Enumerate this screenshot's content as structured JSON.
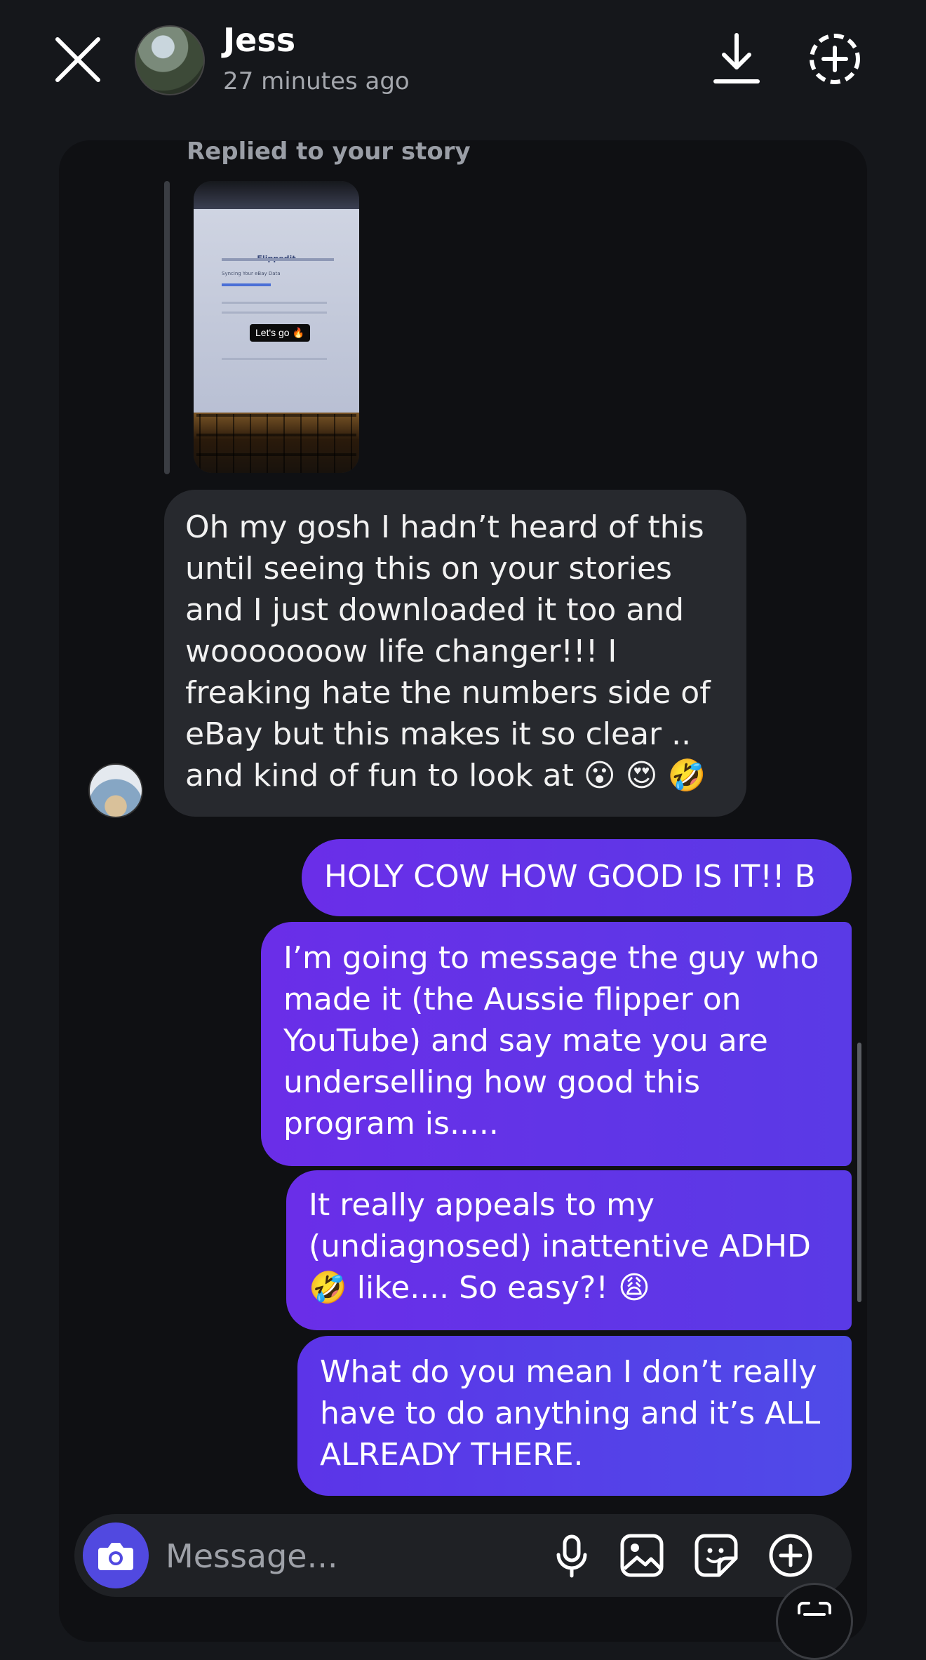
{
  "header": {
    "contact_name": "Jess",
    "last_active": "27 minutes ago",
    "icons": [
      "close-icon",
      "download-icon",
      "add-story-icon"
    ]
  },
  "thread": {
    "replied_label": "Replied to your story",
    "story_preview": {
      "brand": "Flippedit",
      "subtitle": "Syncing Your eBay Data",
      "sticker": "Let's go 🔥"
    },
    "incoming": [
      {
        "text": "Oh my gosh I hadn’t heard of this until seeing this on your stories and I just downloaded it too and wooooooow life changer!!! I freaking hate the numbers side of eBay but this makes it so clear .. and kind of fun to look at 😮 😍 🤣"
      }
    ],
    "outgoing": [
      {
        "text": "HOLY COW HOW GOOD IS IT!! B"
      },
      {
        "text": "I’m going to message the guy who made it (the Aussie flipper on YouTube) and say mate you are underselling how good this program is....."
      },
      {
        "text": "It really appeals to my (undiagnosed) inattentive ADHD 🤣 like.... So easy?! 😩"
      },
      {
        "text": "What do you mean I don’t really have to do anything and it’s ALL ALREADY THERE."
      }
    ]
  },
  "composer": {
    "placeholder": "Message...",
    "accent": "#5149e0",
    "icons": [
      "camera-icon",
      "microphone-icon",
      "gallery-icon",
      "sticker-icon",
      "plus-icon"
    ]
  },
  "colors": {
    "background": "#15171b",
    "incoming_bubble": "#27292e",
    "outgoing_bubble": "#6a2ee8"
  }
}
